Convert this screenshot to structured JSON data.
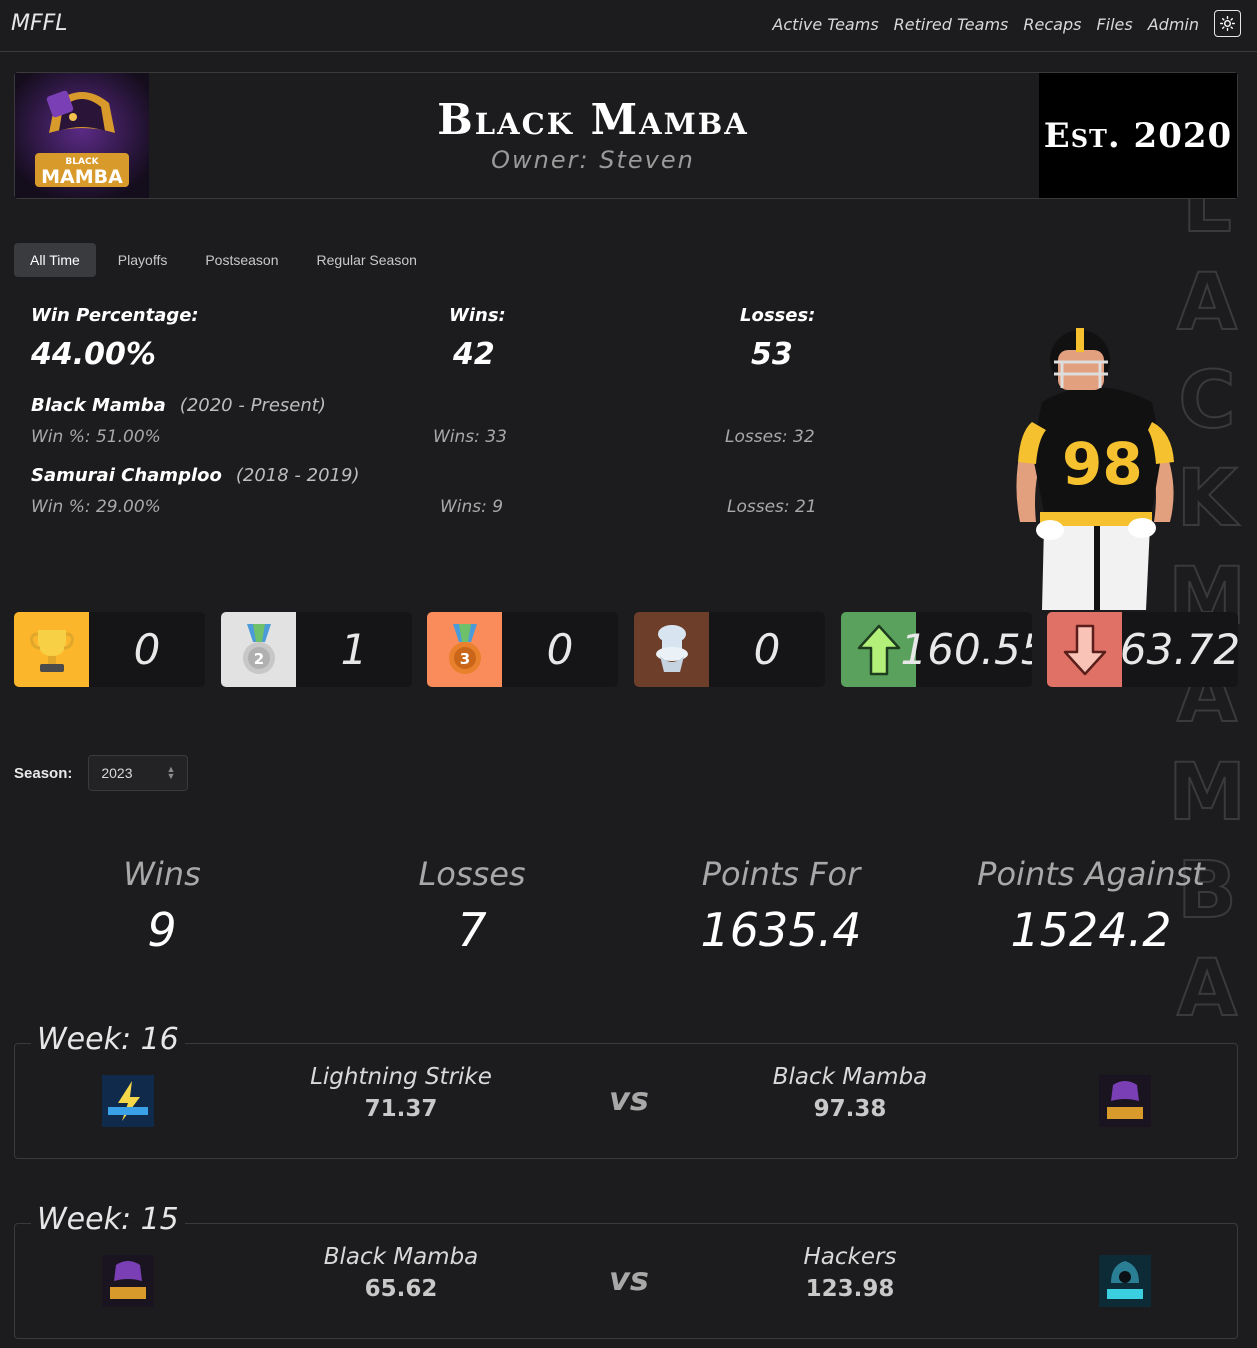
{
  "brand": "MFFL",
  "nav": {
    "links": [
      "Active Teams",
      "Retired Teams",
      "Recaps",
      "Files",
      "Admin"
    ],
    "theme_icon": "sun-icon"
  },
  "banner": {
    "team_name": "Black Mamba",
    "owner": "Owner: Steven",
    "est": "Est. 2020",
    "logo_icon": "black-mamba-logo",
    "watermark": "BLACK MAMBA"
  },
  "tabs": [
    "All Time",
    "Playoffs",
    "Postseason",
    "Regular Season"
  ],
  "summary": {
    "win_pct_label": "Win Percentage:",
    "win_pct": "44.00%",
    "wins_label": "Wins:",
    "wins": "42",
    "losses_label": "Losses:",
    "losses": "53"
  },
  "history": [
    {
      "name": "Black Mamba",
      "years": "(2020 - Present)",
      "win_pct": "Win %: 51.00%",
      "wins": "Wins: 33",
      "losses": "Losses: 32"
    },
    {
      "name": "Samurai Champloo",
      "years": "(2018 - 2019)",
      "win_pct": "Win %: 29.00%",
      "wins": "Wins: 9",
      "losses": "Losses: 21"
    }
  ],
  "awards": [
    {
      "icon": "trophy-icon",
      "value": "0",
      "color": "#fbb62c"
    },
    {
      "icon": "silver-medal-icon",
      "value": "1",
      "color": "#e2e2e2"
    },
    {
      "icon": "bronze-medal-icon",
      "value": "0",
      "color": "#fa8c5b"
    },
    {
      "icon": "toilet-icon",
      "value": "0",
      "color": "#6d3f2a"
    },
    {
      "icon": "arrow-up-icon",
      "value": "160.55",
      "color": "#5aa15e"
    },
    {
      "icon": "arrow-down-icon",
      "value": "63.72",
      "color": "#e07166"
    }
  ],
  "season": {
    "label": "Season:",
    "value": "2023"
  },
  "season_stats": [
    {
      "label": "Wins",
      "value": "9"
    },
    {
      "label": "Losses",
      "value": "7"
    },
    {
      "label": "Points For",
      "value": "1635.4"
    },
    {
      "label": "Points Against",
      "value": "1524.2"
    }
  ],
  "matches": [
    {
      "week": "Week: 16",
      "home": {
        "name": "Lightning Strike",
        "score": "71.37",
        "logo": "lightning-strike-logo"
      },
      "vs": "vs",
      "away": {
        "name": "Black Mamba",
        "score": "97.38",
        "logo": "black-mamba-logo"
      }
    },
    {
      "week": "Week: 15",
      "home": {
        "name": "Black Mamba",
        "score": "65.62",
        "logo": "black-mamba-logo"
      },
      "vs": "vs",
      "away": {
        "name": "Hackers",
        "score": "123.98",
        "logo": "hackers-logo"
      }
    }
  ]
}
